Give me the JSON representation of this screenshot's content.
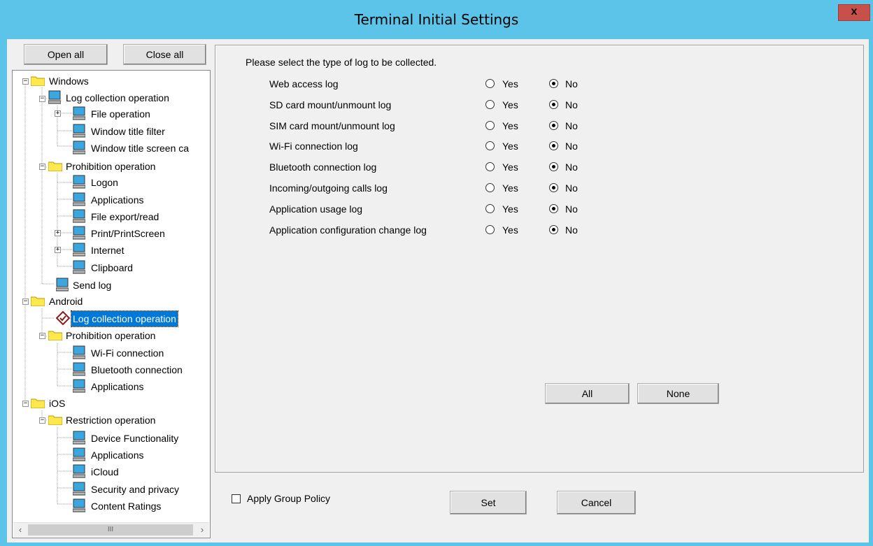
{
  "window": {
    "title": "Terminal Initial Settings",
    "close_label": "x"
  },
  "toolbar": {
    "open_all": "Open all",
    "close_all": "Close all"
  },
  "tree": {
    "windows": "Windows",
    "win_log_collection": "Log collection operation",
    "file_operation": "File operation",
    "window_title_filter": "Window title filter",
    "window_title_screen": "Window title screen ca",
    "win_prohibition": "Prohibition operation",
    "logon": "Logon",
    "win_applications": "Applications",
    "file_export": "File export/read",
    "print_screen": "Print/PrintScreen",
    "internet": "Internet",
    "clipboard": "Clipboard",
    "send_log": "Send log",
    "android": "Android",
    "android_log_collection": "Log collection operation",
    "android_prohibition": "Prohibition operation",
    "wifi_connection": "Wi-Fi connection",
    "bluetooth_connection": "Bluetooth connection",
    "android_applications": "Applications",
    "ios": "iOS",
    "ios_restriction": "Restriction operation",
    "device_functionality": "Device Functionality",
    "ios_applications": "Applications",
    "icloud": "iCloud",
    "security_privacy": "Security and privacy",
    "content_ratings": "Content Ratings",
    "selected": "android_log_collection",
    "scroll_thumb_glyph": "III"
  },
  "panel": {
    "prompt": "Please select the type of log to be collected.",
    "yes_label": "Yes",
    "no_label": "No",
    "logs": [
      {
        "name": "Web access log",
        "value": "No"
      },
      {
        "name": "SD card mount/unmount log",
        "value": "No"
      },
      {
        "name": "SIM card mount/unmount log",
        "value": "No"
      },
      {
        "name": "Wi-Fi connection log",
        "value": "No"
      },
      {
        "name": "Bluetooth connection log",
        "value": "No"
      },
      {
        "name": "Incoming/outgoing calls log",
        "value": "No"
      },
      {
        "name": "Application usage log",
        "value": "No"
      },
      {
        "name": "Application configuration change log",
        "value": "No"
      }
    ],
    "all_button": "All",
    "none_button": "None"
  },
  "footer": {
    "apply_group_policy": "Apply Group Policy",
    "apply_group_policy_checked": false,
    "set_button": "Set",
    "cancel_button": "Cancel"
  },
  "colors": {
    "titlebar": "#5bc4e8",
    "close": "#c7514a",
    "selection": "#0078d7"
  }
}
